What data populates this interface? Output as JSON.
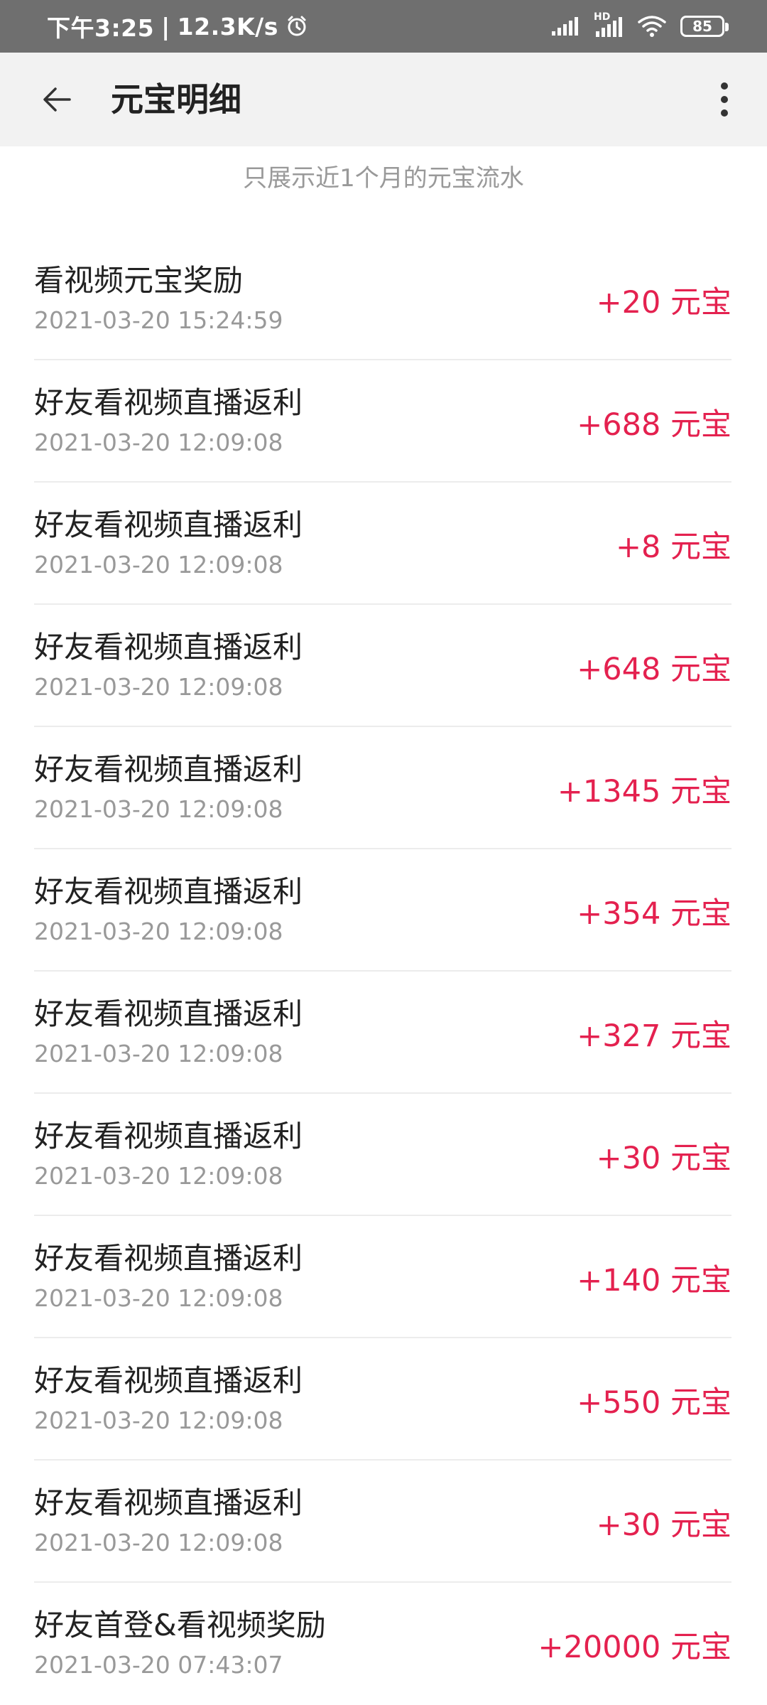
{
  "status_bar": {
    "time": "下午3:25",
    "separator": "|",
    "speed": "12.3K/s",
    "battery": "85",
    "hd_label": "HD",
    "icons": [
      "alarm-icon",
      "cellular-signal-icon",
      "hd-signal-icon",
      "wifi-icon",
      "battery-icon"
    ]
  },
  "header": {
    "title": "元宝明细",
    "back_icon": "arrow-left-icon",
    "more_icon": "more-vertical-icon"
  },
  "notice": "只展示近1个月的元宝流水",
  "transactions": [
    {
      "title": "看视频元宝奖励",
      "time": "2021-03-20 15:24:59",
      "amount": "+20 元宝"
    },
    {
      "title": "好友看视频直播返利",
      "time": "2021-03-20 12:09:08",
      "amount": "+688 元宝"
    },
    {
      "title": "好友看视频直播返利",
      "time": "2021-03-20 12:09:08",
      "amount": "+8 元宝"
    },
    {
      "title": "好友看视频直播返利",
      "time": "2021-03-20 12:09:08",
      "amount": "+648 元宝"
    },
    {
      "title": "好友看视频直播返利",
      "time": "2021-03-20 12:09:08",
      "amount": "+1345 元宝"
    },
    {
      "title": "好友看视频直播返利",
      "time": "2021-03-20 12:09:08",
      "amount": "+354 元宝"
    },
    {
      "title": "好友看视频直播返利",
      "time": "2021-03-20 12:09:08",
      "amount": "+327 元宝"
    },
    {
      "title": "好友看视频直播返利",
      "time": "2021-03-20 12:09:08",
      "amount": "+30 元宝"
    },
    {
      "title": "好友看视频直播返利",
      "time": "2021-03-20 12:09:08",
      "amount": "+140 元宝"
    },
    {
      "title": "好友看视频直播返利",
      "time": "2021-03-20 12:09:08",
      "amount": "+550 元宝"
    },
    {
      "title": "好友看视频直播返利",
      "time": "2021-03-20 12:09:08",
      "amount": "+30 元宝"
    },
    {
      "title": "好友首登&看视频奖励",
      "time": "2021-03-20 07:43:07",
      "amount": "+20000 元宝"
    }
  ],
  "colors": {
    "amount": "#e4214f",
    "status_bar_bg": "#6f6f6f",
    "app_bar_bg": "#f2f2f2"
  }
}
